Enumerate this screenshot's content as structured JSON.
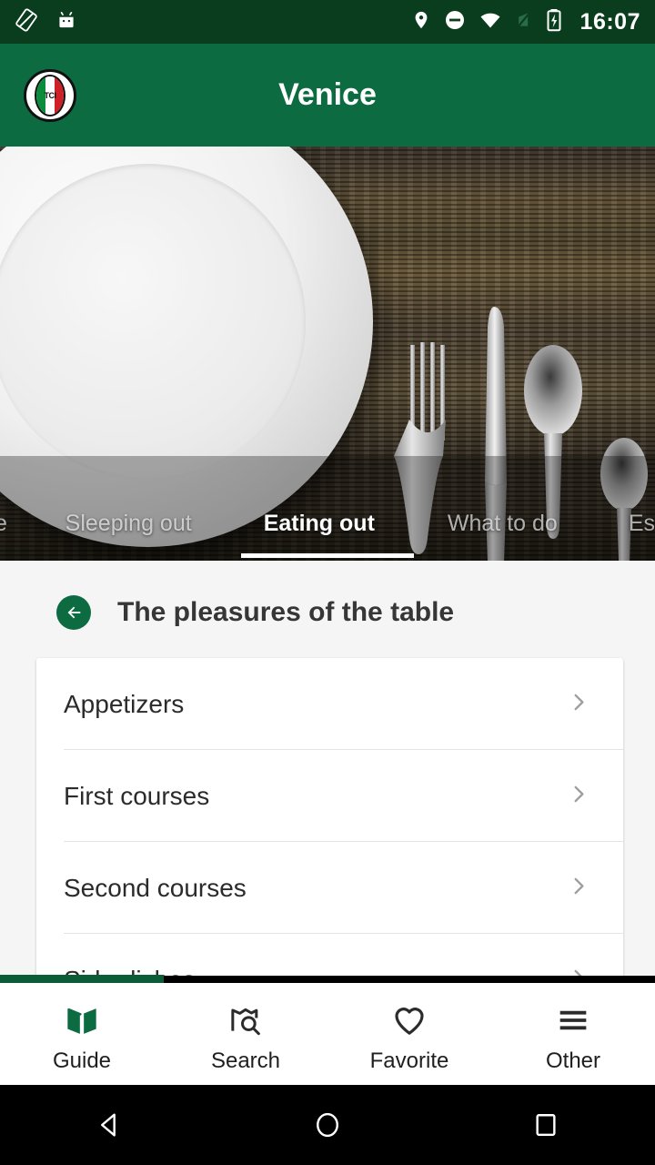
{
  "status_bar": {
    "time": "16:07",
    "icons": [
      "screen-rotation-icon",
      "android-head-icon",
      "location-pin-icon",
      "do-not-disturb-icon",
      "wifi-icon",
      "mobile-signal-off-icon",
      "battery-charging-icon"
    ],
    "background_color": "#0a3d1e"
  },
  "app_bar": {
    "title": "Venice",
    "logo_name": "tci-logo",
    "logo_text": "TCI",
    "background_color": "#0d6b42"
  },
  "hero": {
    "image_description": "table-setting-photo"
  },
  "tabs": {
    "items": [
      {
        "label": "e",
        "active": false,
        "partial": true
      },
      {
        "label": "Sleeping out",
        "active": false,
        "partial": false
      },
      {
        "label": "Eating out",
        "active": true,
        "partial": false
      },
      {
        "label": "What to do",
        "active": false,
        "partial": false
      },
      {
        "label": "Es",
        "active": false,
        "partial": true
      }
    ],
    "indicator_color": "#ffffff"
  },
  "section": {
    "back_label": "back-arrow",
    "title": "The pleasures of the table",
    "accent_color": "#0d6b42"
  },
  "list": {
    "items": [
      {
        "label": "Appetizers"
      },
      {
        "label": "First courses"
      },
      {
        "label": "Second courses"
      },
      {
        "label": "Side dishes"
      }
    ],
    "chevron_color": "#9e9e9e"
  },
  "bottom_nav": {
    "items": [
      {
        "label": "Guide",
        "icon": "book-icon",
        "active": true
      },
      {
        "label": "Search",
        "icon": "map-search-icon",
        "active": false
      },
      {
        "label": "Favorite",
        "icon": "heart-icon",
        "active": false
      },
      {
        "label": "Other",
        "icon": "hamburger-menu-icon",
        "active": false
      }
    ],
    "active_color": "#0d6b42"
  },
  "android_nav": {
    "buttons": [
      {
        "name": "back-button",
        "icon": "triangle-left-icon"
      },
      {
        "name": "home-button",
        "icon": "circle-icon"
      },
      {
        "name": "recents-button",
        "icon": "square-icon"
      }
    ]
  }
}
